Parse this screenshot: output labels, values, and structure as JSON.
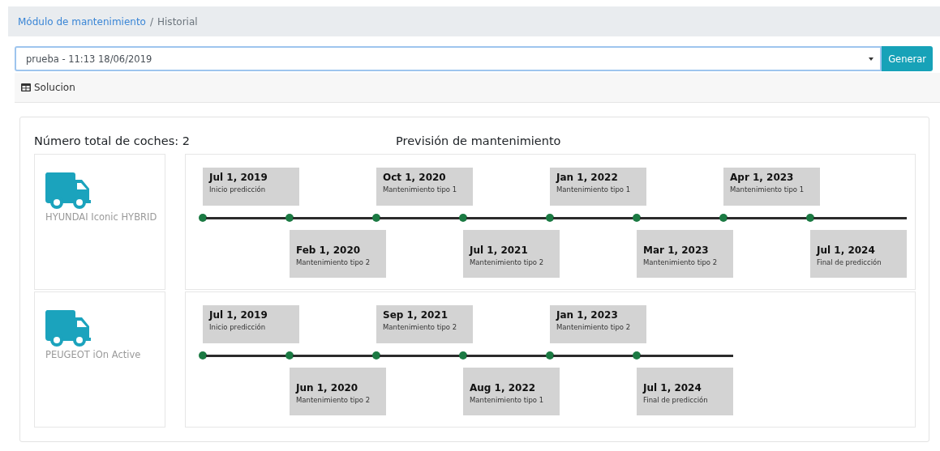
{
  "breadcrumb": [
    {
      "label": "Módulo de mantenimiento",
      "kind": "link"
    },
    {
      "label": "Historial",
      "kind": "current"
    }
  ],
  "breadcrumb_separator": "/",
  "selector": {
    "value": "prueba - 11:13 18/06/2019",
    "button": "Generar"
  },
  "section_tab": {
    "label": "Solucion"
  },
  "summary": {
    "total_label": "Número total de coches: 2",
    "timeline_title": "Previsión de mantenimiento"
  },
  "cars": [
    {
      "name": "HYUNDAI Iconic HYBRID",
      "events": [
        {
          "date": "Jul 1, 2019",
          "label": "Inicio predicción",
          "kind": "above"
        },
        {
          "date": "Feb 1, 2020",
          "label": "Mantenimiento tipo 2",
          "kind": "below"
        },
        {
          "date": "Oct 1, 2020",
          "label": "Mantenimiento tipo 1",
          "kind": "above"
        },
        {
          "date": "Jul 1, 2021",
          "label": "Mantenimiento tipo 2",
          "kind": "below"
        },
        {
          "date": "Jan 1, 2022",
          "label": "Mantenimiento tipo 1",
          "kind": "above"
        },
        {
          "date": "Mar 1, 2023",
          "label": "Mantenimiento tipo 2",
          "kind": "below"
        },
        {
          "date": "Apr 1, 2023",
          "label": "Mantenimiento tipo 1",
          "kind": "above"
        },
        {
          "date": "Jul 1, 2024",
          "label": "Final de predicción",
          "kind": "below"
        }
      ]
    },
    {
      "name": "PEUGEOT iOn Active",
      "events": [
        {
          "date": "Jul 1, 2019",
          "label": "Inicio predicción",
          "kind": "above"
        },
        {
          "date": "Jun 1, 2020",
          "label": "Mantenimiento tipo 2",
          "kind": "below"
        },
        {
          "date": "Sep 1, 2021",
          "label": "Mantenimiento tipo 2",
          "kind": "above"
        },
        {
          "date": "Aug 1, 2022",
          "label": "Mantenimiento tipo 1",
          "kind": "below"
        },
        {
          "date": "Jan 1, 2023",
          "label": "Mantenimiento tipo 2",
          "kind": "above"
        },
        {
          "date": "Jul 1, 2024",
          "label": "Final de predicción",
          "kind": "below"
        }
      ]
    }
  ]
}
